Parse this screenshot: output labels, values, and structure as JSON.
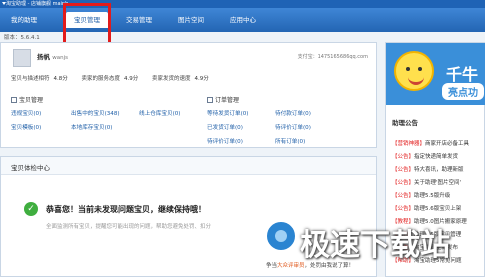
{
  "window": {
    "title": "淘宝助理 - 店铺旗舰 mainb"
  },
  "nav": {
    "tabs": [
      "我的助理",
      "宝贝管理",
      "交易管理",
      "图片空间",
      "应用中心"
    ],
    "active_index": 1
  },
  "version": "版本：5.6.4.1",
  "account": {
    "name": "扬帆",
    "name_suffix": "wanjs",
    "alipay": "支付宝：1475165686qq.com",
    "scores": [
      {
        "label": "宝贝与描述相符",
        "value": "4.8分"
      },
      {
        "label": "卖家的服务态度",
        "value": "4.9分"
      },
      {
        "label": "卖家发货的速度",
        "value": "4.9分"
      }
    ]
  },
  "baby_mgmt": {
    "title": "宝贝管理",
    "links": [
      "违规宝贝(0)",
      "出售中的宝贝(348)",
      "线上仓库宝贝(0)",
      "宝贝模板(0)",
      "本地库存宝贝(0)"
    ]
  },
  "order_mgmt": {
    "title": "订单管理",
    "links": [
      "等待发货订单(0)",
      "待付款订单(0)",
      "已发货订单(0)",
      "待评价订单(0)",
      "待评价订单(0)",
      "所有订单(0)"
    ]
  },
  "baby_check": {
    "title": "宝贝体检中心",
    "message": "恭喜您！当前未发现问题宝贝，继续保持哦！",
    "subtext": "全面监测所有宝贝，提醒您可能出现的问题，帮助您避免处罚、扣分",
    "footer_prefix": "争当",
    "footer_em": "大众评审员",
    "footer_suffix": "，处罚由我说了算！"
  },
  "sidebar": {
    "banner_big": "千牛",
    "banner_bubble": "亮点功",
    "ann_title": "助理公告",
    "announcements": [
      {
        "tag": "【营销神器】",
        "text": "商家开店必备工具"
      },
      {
        "tag": "【公告】",
        "text": "指定快递简单发货"
      },
      {
        "tag": "【公告】",
        "text": "特大喜讯，助理新版"
      },
      {
        "tag": "【公告】",
        "text": "关于助理'图片空间'"
      },
      {
        "tag": "【公告】",
        "text": "助理5.5版升级"
      },
      {
        "tag": "【公告】",
        "text": "助理5.6版宝贝上架"
      },
      {
        "tag": "【教程】",
        "text": "助理5.0图片搬家原理"
      },
      {
        "tag": "【公告】",
        "text": "助理5.5版宝贝管理"
      },
      {
        "tag": "【公告】",
        "text": "淘宝助理全新发布"
      },
      {
        "tag": "【帮助】",
        "text": "淘宝助理5常见问题"
      }
    ]
  },
  "watermark": "极速下载站"
}
